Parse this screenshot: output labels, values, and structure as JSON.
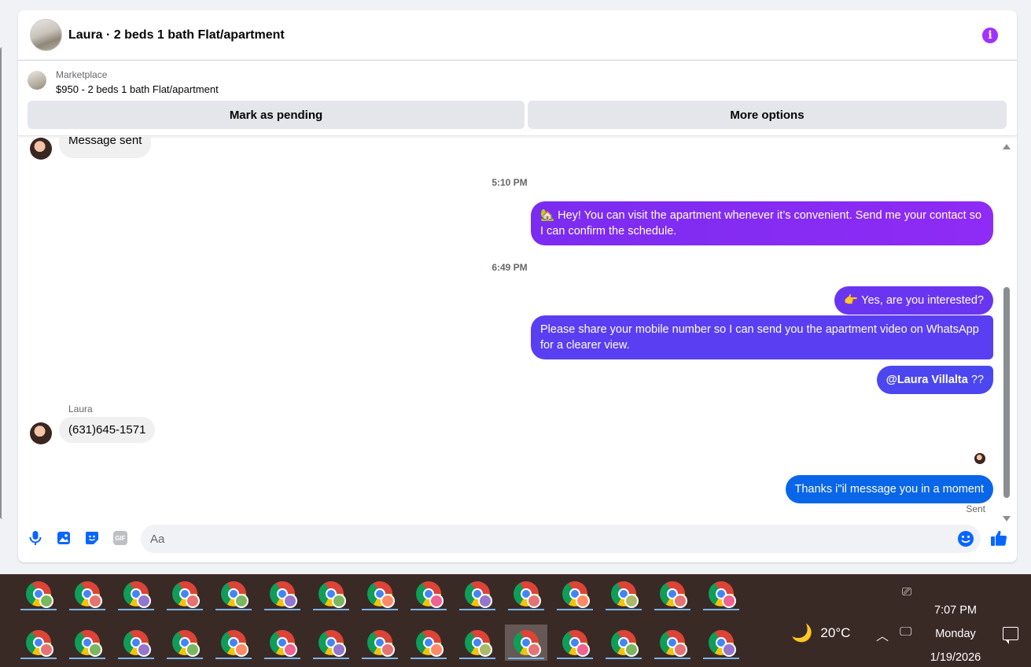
{
  "header": {
    "title": "Laura · 2 beds 1 bath Flat/apartment",
    "info_icon": "info-icon"
  },
  "marketplace": {
    "label": "Marketplace",
    "listing": "$950 - 2 beds 1 bath Flat/apartment",
    "mark_pending": "Mark as pending",
    "more_options": "More options"
  },
  "messages": {
    "first_incoming": "Message sent",
    "time1": "5:10 PM",
    "out1_emoji": "🏡",
    "out1_text": "Hey! You can visit the apartment whenever it’s convenient. Send me your contact so I can confirm the schedule.",
    "time2": "6:49 PM",
    "out2_emoji": "👉",
    "out2_text": "Yes, are you interested?",
    "out3_text": "Please share your mobile number so I can send you the apartment video on WhatsApp for a clearer view.",
    "out4_mention": "@Laura Villalta",
    "out4_text": " ??",
    "sender_name": "Laura",
    "incoming_phone": "(631)645-1571",
    "out5_text": "Thanks i\"il message you in a moment",
    "sent_label": "Sent"
  },
  "composer": {
    "placeholder": "Aa",
    "gif_label": "GIF"
  },
  "taskbar": {
    "weather_temp": "20°C",
    "weather_icon": "moon-icon",
    "time": "7:07 PM",
    "day": "Monday",
    "date": "1/19/2026"
  },
  "colors": {
    "accent_purple": "#a033ff",
    "bubble_violet": "#8a2be2",
    "bubble_indigo": "#5b3df5",
    "bubble_blue": "#0a66e8",
    "messenger_blue": "#0866ff"
  }
}
